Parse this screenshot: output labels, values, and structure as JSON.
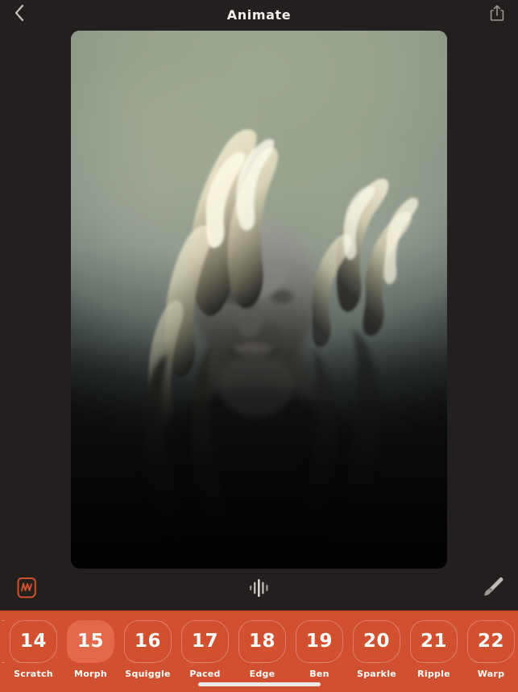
{
  "app": {
    "background_color": "#221F1E",
    "accent_color": "#D0502F",
    "selected_chip_color": "#E2694A"
  },
  "header": {
    "title": "Animate",
    "back_icon": "chevron-left-icon",
    "share_icon": "share-icon"
  },
  "canvas": {
    "artwork_alt": "Digital painting of an upturned face shrouded by flowing cream and dark smoke-like hair on a sage green to black gradient background",
    "background_top_color": "#9BA693",
    "background_bottom_color": "#0B0C0C",
    "wisp_color": "#EDE8CE"
  },
  "toolbar": {
    "left_icon": "waveform-squiggle-icon",
    "center_icon": "audio-waveform-icon",
    "right_icon": "paintbrush-icon"
  },
  "effects": {
    "selected_index": 1,
    "items": [
      {
        "number": "14",
        "label": "Scratch"
      },
      {
        "number": "15",
        "label": "Morph"
      },
      {
        "number": "16",
        "label": "Squiggle"
      },
      {
        "number": "17",
        "label": "Paced"
      },
      {
        "number": "18",
        "label": "Edge"
      },
      {
        "number": "19",
        "label": "Ben"
      },
      {
        "number": "20",
        "label": "Sparkle"
      },
      {
        "number": "21",
        "label": "Ripple"
      },
      {
        "number": "22",
        "label": "Warp"
      }
    ]
  }
}
